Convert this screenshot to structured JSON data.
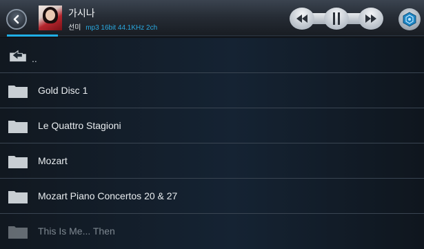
{
  "now_playing": {
    "title": "가시나",
    "artist": "선미",
    "format": "mp3 16bit 44.1KHz 2ch"
  },
  "icons": {
    "back": "back-arrow-icon",
    "rewind": "rewind-icon",
    "pause": "pause-icon",
    "fast_forward": "fast-forward-icon",
    "settings": "hexagon-settings-icon",
    "folder": "folder-icon",
    "parent": "up-folder-icon"
  },
  "list": {
    "parent_label": "..",
    "items": [
      {
        "label": "Gold Disc 1"
      },
      {
        "label": "Le Quattro Stagioni"
      },
      {
        "label": "Mozart"
      },
      {
        "label": "Mozart Piano Concertos 20 & 27"
      },
      {
        "label": "This Is Me... Then"
      }
    ]
  },
  "colors": {
    "accent": "#1eaee6",
    "format_text": "#2aa9e0"
  }
}
